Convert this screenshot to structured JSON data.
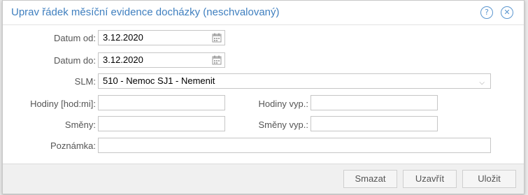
{
  "background": {
    "text": "~ ~ ~ ~ ~ ~~~~~~~~~~~~~~ ~ ~"
  },
  "dialog": {
    "title": "Uprav řádek měsíční evidence docházky (neschvalovaný)",
    "help_glyph": "?",
    "close_glyph": "✕"
  },
  "form": {
    "datum_od_label": "Datum od:",
    "datum_od_value": "3.12.2020",
    "datum_do_label": "Datum do:",
    "datum_do_value": "3.12.2020",
    "slm_label": "SLM:",
    "slm_value": "510 - Nemoc SJ1 - Nemenit",
    "slm_options_visible": [
      "510 - Nemoc SJ1 - Nemenit"
    ],
    "hodiny_label": "Hodiny [hod:mi]:",
    "hodiny_value": "",
    "hodiny_vyp_label": "Hodiny vyp.:",
    "hodiny_vyp_value": "",
    "smeny_label": "Směny:",
    "smeny_value": "",
    "smeny_vyp_label": "Směny vyp.:",
    "smeny_vyp_value": "",
    "poznamka_label": "Poznámka:",
    "poznamka_value": ""
  },
  "footer": {
    "delete_label": "Smazat",
    "close_label": "Uzavřít",
    "save_label": "Uložit"
  },
  "icons": {
    "help": "help-icon",
    "close": "close-icon",
    "calendar": "calendar-icon",
    "dropdown": "chevron-down-icon"
  },
  "colors": {
    "title": "#3f7fbf",
    "accent": "#5b96cf",
    "footer_bg": "#f0f0f0",
    "border": "#c6c6c6"
  }
}
